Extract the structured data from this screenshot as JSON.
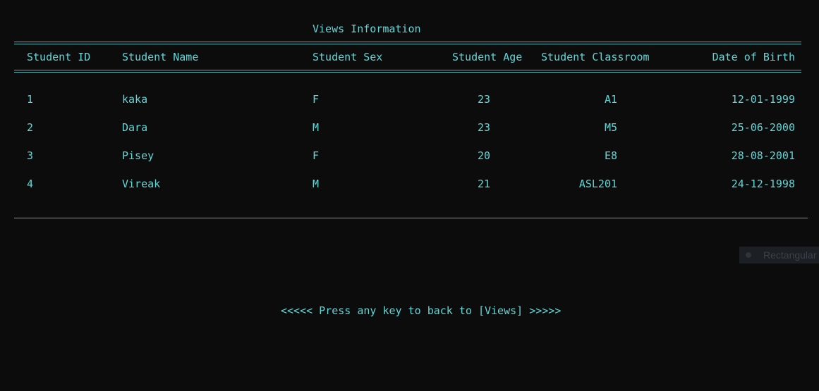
{
  "title": "Views Information",
  "headers": {
    "id": "Student ID",
    "name": "Student Name",
    "sex": "Student Sex",
    "age": "Student Age",
    "classroom": "Student Classroom",
    "dob": "Date of Birth"
  },
  "rows": [
    {
      "id": "1",
      "name": "kaka",
      "sex": "F",
      "age": "23",
      "classroom": "A1",
      "dob": "12-01-1999"
    },
    {
      "id": "2",
      "name": "Dara",
      "sex": "M",
      "age": "23",
      "classroom": "M5",
      "dob": "25-06-2000"
    },
    {
      "id": "3",
      "name": "Pisey",
      "sex": "F",
      "age": "20",
      "classroom": "E8",
      "dob": "28-08-2001"
    },
    {
      "id": "4",
      "name": "Vireak",
      "sex": "M",
      "age": "21",
      "classroom": "ASL201",
      "dob": "24-12-1998"
    }
  ],
  "tooltip": {
    "icon": "circle-icon",
    "label": "Rectangular"
  },
  "footer": "<<<<< Press any key to back to [Views] >>>>>",
  "colors": {
    "background": "#0c0c0c",
    "text": "#61d6d6"
  }
}
